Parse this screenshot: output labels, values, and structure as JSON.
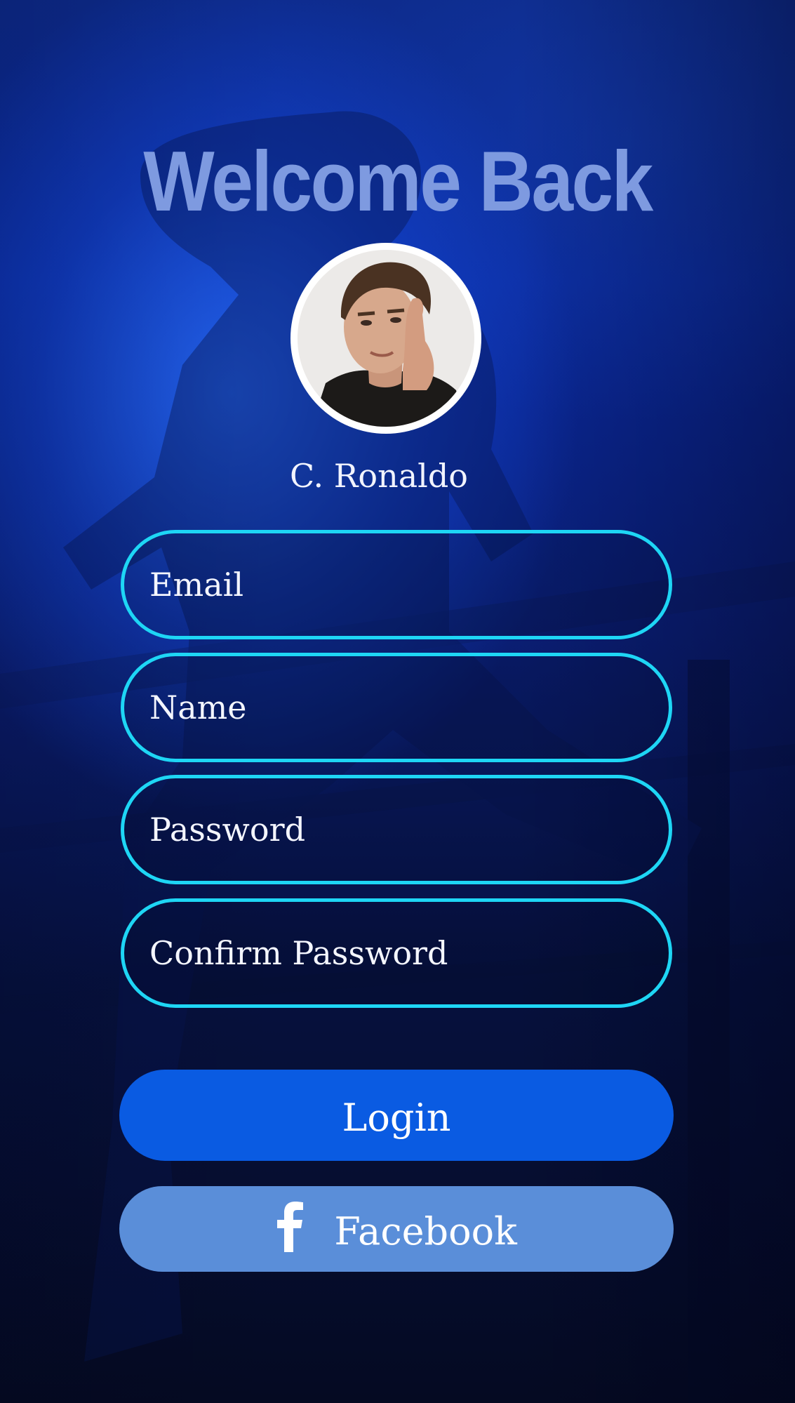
{
  "header": {
    "title": "Welcome Back"
  },
  "profile": {
    "name": "C. Ronaldo",
    "avatar_icon": "user-portrait-avatar"
  },
  "form": {
    "fields": [
      {
        "placeholder": "Email"
      },
      {
        "placeholder": "Name"
      },
      {
        "placeholder": "Password"
      },
      {
        "placeholder": "Confirm Password"
      }
    ]
  },
  "actions": {
    "login_label": "Login",
    "facebook_label": "Facebook",
    "facebook_icon": "facebook-f-icon"
  },
  "colors": {
    "title": "#7e9ae0",
    "field_border": "#1ed6f5",
    "login_button": "#0a5be2",
    "facebook_button": "#5a8ed9",
    "background": "#0a1e74"
  }
}
